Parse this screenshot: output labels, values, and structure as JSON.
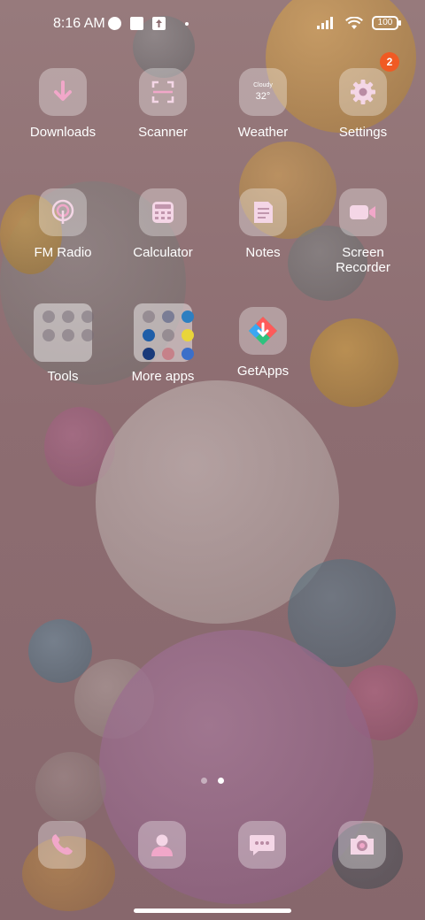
{
  "status_bar": {
    "time": "8:16 AM",
    "battery": "100",
    "icons": [
      "app-notif-icon",
      "square-notif-icon",
      "upload-notif-icon",
      "signal-icon",
      "wifi-icon",
      "battery-icon"
    ]
  },
  "apps": {
    "downloads": "Downloads",
    "scanner": "Scanner",
    "weather": "Weather",
    "weather_condition": "Cloudy",
    "weather_temp": "32°",
    "settings": "Settings",
    "settings_badge": "2",
    "fm_radio": "FM Radio",
    "calculator": "Calculator",
    "notes": "Notes",
    "screen_recorder_line1": "Screen",
    "screen_recorder_line2": "Recorder",
    "tools": "Tools",
    "more_apps": "More apps",
    "getapps": "GetApps"
  },
  "pages": {
    "count": 2,
    "current": 2
  },
  "dock": [
    "phone-icon",
    "contacts-icon",
    "messages-icon",
    "camera-icon"
  ],
  "colors": {
    "accent_pink": "#f1a7c9",
    "badge": "#f05a23"
  }
}
